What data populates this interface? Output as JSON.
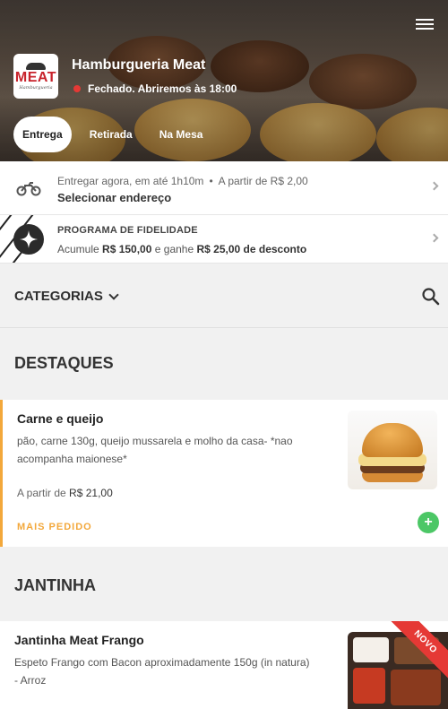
{
  "header": {
    "store_name": "Hamburgueria Meat",
    "status": "Fechado. Abriremos às 18:00",
    "status_color": "#e53935",
    "logo_text": "MEAT",
    "logo_sub": "Hamburgueria",
    "menu_icon": "hamburger-menu-icon"
  },
  "tabs": [
    {
      "label": "Entrega",
      "active": true
    },
    {
      "label": "Retirada",
      "active": false
    },
    {
      "label": "Na Mesa",
      "active": false
    }
  ],
  "delivery": {
    "icon": "motorcycle-icon",
    "time": "Entregar agora, em até 1h10m",
    "min_price": "A partir de R$ 2,00",
    "address": "Selecionar endereço"
  },
  "loyalty": {
    "icon": "sparkle-badge-icon",
    "title": "PROGRAMA DE FIDELIDADE",
    "desc_pre": "Acumule",
    "amount": "R$ 150,00",
    "desc_mid": "e ganhe",
    "reward": "R$ 25,00 de desconto"
  },
  "categories": {
    "label": "CATEGORIAS",
    "search_icon": "search-icon"
  },
  "sections": [
    {
      "title": "DESTAQUES",
      "products": [
        {
          "name": "Carne e queijo",
          "description": "pão, carne 130g, queijo mussarela e molho da casa- *nao acompanha maionese*",
          "price_prefix": "A partir de",
          "price": "R$ 21,00",
          "tag": "MAIS PEDIDO",
          "add_label": "+"
        }
      ]
    },
    {
      "title": "JANTINHA",
      "products": [
        {
          "name": "Jantinha Meat Frango",
          "description_line1": "Espeto Frango com Bacon aproximadamente 150g (in natura)",
          "description_line2": "- Arroz",
          "badge": "NOVO"
        }
      ]
    }
  ],
  "colors": {
    "accent": "#f3a83b",
    "add_button": "#4cc766",
    "badge": "#e53935"
  }
}
